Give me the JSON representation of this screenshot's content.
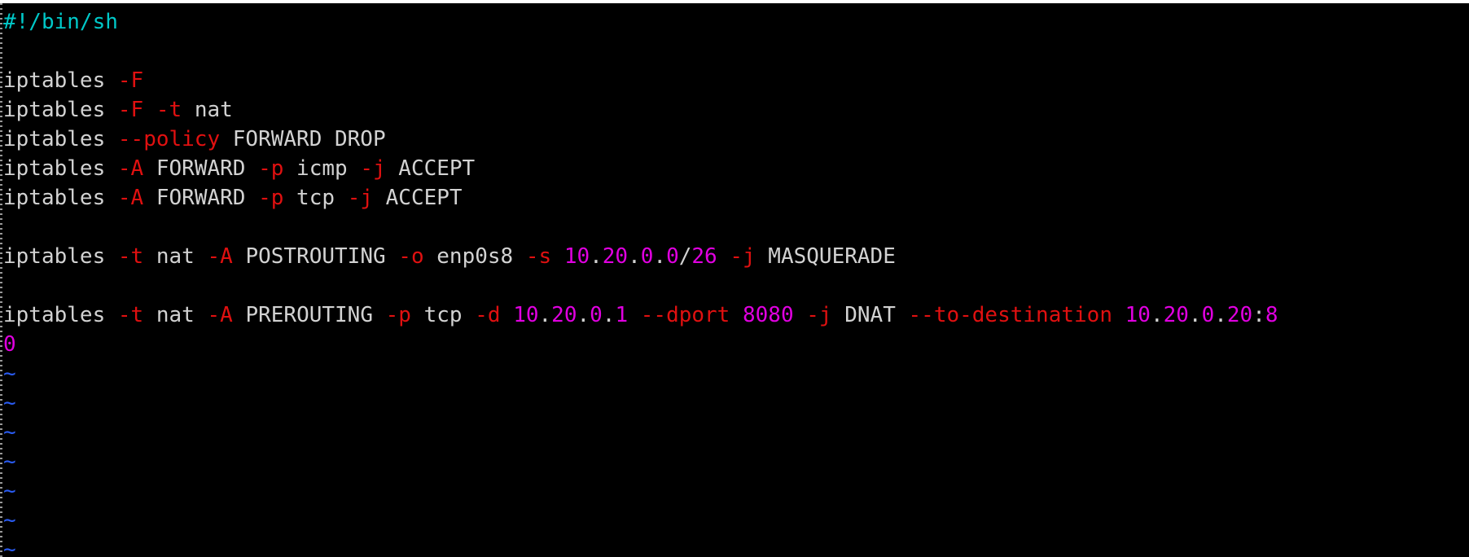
{
  "editor": {
    "shebang": "#!/bin/sh",
    "lines": [
      {
        "tokens": [
          {
            "t": "#!/bin/sh",
            "c": "shebang"
          }
        ]
      },
      {
        "tokens": []
      },
      {
        "tokens": [
          {
            "t": "iptables ",
            "c": "cmd"
          },
          {
            "t": "-F",
            "c": "flag"
          }
        ]
      },
      {
        "tokens": [
          {
            "t": "iptables ",
            "c": "cmd"
          },
          {
            "t": "-F",
            "c": "flag"
          },
          {
            "t": " ",
            "c": "text"
          },
          {
            "t": "-t",
            "c": "flag"
          },
          {
            "t": " nat",
            "c": "text"
          }
        ]
      },
      {
        "tokens": [
          {
            "t": "iptables ",
            "c": "cmd"
          },
          {
            "t": "--policy",
            "c": "flag"
          },
          {
            "t": " FORWARD DROP",
            "c": "text"
          }
        ]
      },
      {
        "tokens": [
          {
            "t": "iptables ",
            "c": "cmd"
          },
          {
            "t": "-A",
            "c": "flag"
          },
          {
            "t": " FORWARD ",
            "c": "text"
          },
          {
            "t": "-p",
            "c": "flag"
          },
          {
            "t": " icmp ",
            "c": "text"
          },
          {
            "t": "-j",
            "c": "flag"
          },
          {
            "t": " ACCEPT",
            "c": "text"
          }
        ]
      },
      {
        "tokens": [
          {
            "t": "iptables ",
            "c": "cmd"
          },
          {
            "t": "-A",
            "c": "flag"
          },
          {
            "t": " FORWARD ",
            "c": "text"
          },
          {
            "t": "-p",
            "c": "flag"
          },
          {
            "t": " tcp ",
            "c": "text"
          },
          {
            "t": "-j",
            "c": "flag"
          },
          {
            "t": " ACCEPT",
            "c": "text"
          }
        ]
      },
      {
        "tokens": []
      },
      {
        "tokens": [
          {
            "t": "iptables ",
            "c": "cmd"
          },
          {
            "t": "-t",
            "c": "flag"
          },
          {
            "t": " nat ",
            "c": "text"
          },
          {
            "t": "-A",
            "c": "flag"
          },
          {
            "t": " POSTROUTING ",
            "c": "text"
          },
          {
            "t": "-o",
            "c": "flag"
          },
          {
            "t": " enp0s8 ",
            "c": "text"
          },
          {
            "t": "-s",
            "c": "flag"
          },
          {
            "t": " ",
            "c": "text"
          },
          {
            "t": "10",
            "c": "num"
          },
          {
            "t": ".",
            "c": "dot"
          },
          {
            "t": "20",
            "c": "num"
          },
          {
            "t": ".",
            "c": "dot"
          },
          {
            "t": "0",
            "c": "num"
          },
          {
            "t": ".",
            "c": "dot"
          },
          {
            "t": "0",
            "c": "num"
          },
          {
            "t": "/",
            "c": "dot"
          },
          {
            "t": "26",
            "c": "num"
          },
          {
            "t": " ",
            "c": "text"
          },
          {
            "t": "-j",
            "c": "flag"
          },
          {
            "t": " MASQUERADE",
            "c": "text"
          }
        ]
      },
      {
        "tokens": []
      },
      {
        "tokens": [
          {
            "t": "iptables ",
            "c": "cmd"
          },
          {
            "t": "-t",
            "c": "flag"
          },
          {
            "t": " nat ",
            "c": "text"
          },
          {
            "t": "-A",
            "c": "flag"
          },
          {
            "t": " PREROUTING ",
            "c": "text"
          },
          {
            "t": "-p",
            "c": "flag"
          },
          {
            "t": " tcp ",
            "c": "text"
          },
          {
            "t": "-d",
            "c": "flag"
          },
          {
            "t": " ",
            "c": "text"
          },
          {
            "t": "10",
            "c": "num"
          },
          {
            "t": ".",
            "c": "dot"
          },
          {
            "t": "20",
            "c": "num"
          },
          {
            "t": ".",
            "c": "dot"
          },
          {
            "t": "0",
            "c": "num"
          },
          {
            "t": ".",
            "c": "dot"
          },
          {
            "t": "1",
            "c": "num"
          },
          {
            "t": " ",
            "c": "text"
          },
          {
            "t": "--dport",
            "c": "flag"
          },
          {
            "t": " ",
            "c": "text"
          },
          {
            "t": "8080",
            "c": "num"
          },
          {
            "t": " ",
            "c": "text"
          },
          {
            "t": "-j",
            "c": "flag"
          },
          {
            "t": " DNAT ",
            "c": "text"
          },
          {
            "t": "--to-destination",
            "c": "flag"
          },
          {
            "t": " ",
            "c": "text"
          },
          {
            "t": "10",
            "c": "num"
          },
          {
            "t": ".",
            "c": "dot"
          },
          {
            "t": "20",
            "c": "num"
          },
          {
            "t": ".",
            "c": "dot"
          },
          {
            "t": "0",
            "c": "num"
          },
          {
            "t": ".",
            "c": "dot"
          },
          {
            "t": "20",
            "c": "num"
          },
          {
            "t": ":",
            "c": "dot"
          },
          {
            "t": "8",
            "c": "num"
          }
        ]
      },
      {
        "tokens": [
          {
            "t": "0",
            "c": "num"
          }
        ]
      }
    ],
    "tilde_lines": [
      "~",
      "~",
      "~",
      "~",
      "~",
      "~",
      "~"
    ]
  },
  "colors": {
    "background": "#000000",
    "text": "#d2d2d2",
    "flag": "#e01010",
    "number": "#e000e0",
    "shebang": "#00c8c8",
    "tilde": "#2a5cf4"
  }
}
